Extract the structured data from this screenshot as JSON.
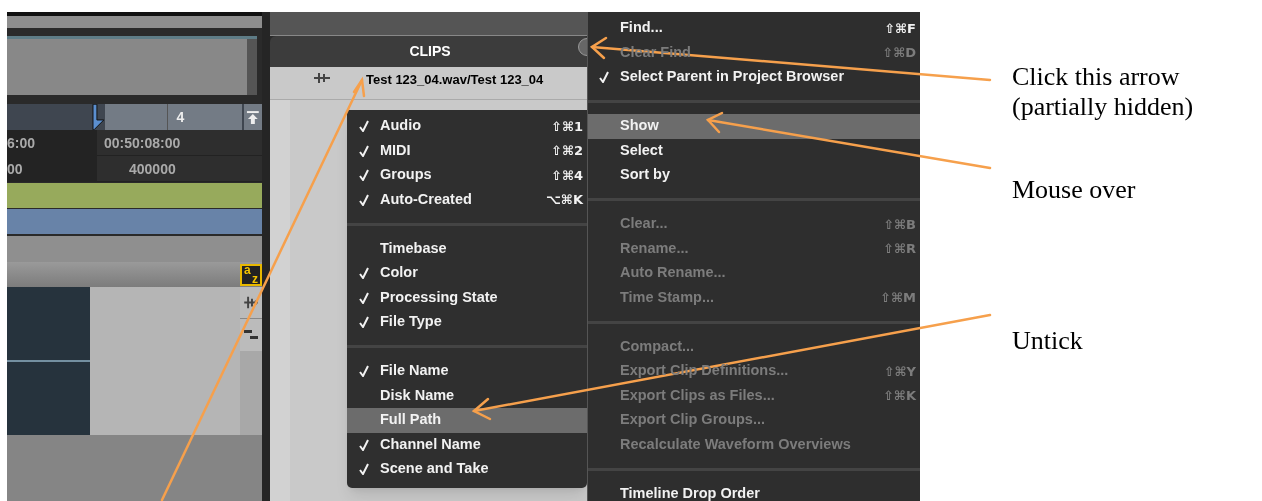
{
  "timeline": {
    "bar_number": "4",
    "rows": [
      [
        "6:00",
        "00:50:08:00"
      ],
      [
        "00",
        "400000"
      ]
    ]
  },
  "sort_button": {
    "top": "a",
    "bottom": "z"
  },
  "clips": {
    "title": "CLIPS",
    "rows": [
      "Test 123_04.wav/Test 123_04"
    ]
  },
  "show_submenu": {
    "groups": [
      [
        {
          "label": "Audio",
          "shortcut": "⇧⌘1",
          "checked": true,
          "selected": false
        },
        {
          "label": "MIDI",
          "shortcut": "⇧⌘2",
          "checked": true,
          "selected": false
        },
        {
          "label": "Groups",
          "shortcut": "⇧⌘4",
          "checked": true,
          "selected": false
        },
        {
          "label": "Auto-Created",
          "shortcut": "⌥⌘K",
          "checked": true,
          "selected": false
        }
      ],
      [
        {
          "label": "Timebase",
          "checked": false,
          "selected": false
        },
        {
          "label": "Color",
          "checked": true,
          "selected": false
        },
        {
          "label": "Processing State",
          "checked": true,
          "selected": false
        },
        {
          "label": "File Type",
          "checked": true,
          "selected": false
        }
      ],
      [
        {
          "label": "File Name",
          "checked": true,
          "selected": false
        },
        {
          "label": "Disk Name",
          "checked": false,
          "selected": false
        },
        {
          "label": "Full Path",
          "checked": false,
          "selected": true
        },
        {
          "label": "Channel Name",
          "checked": true,
          "selected": false
        },
        {
          "label": "Scene and Take",
          "checked": true,
          "selected": false
        }
      ]
    ]
  },
  "menu": {
    "groups": [
      [
        {
          "label": "Find...",
          "shortcut": "⇧⌘F",
          "checked": false,
          "disabled": false,
          "selected": false
        },
        {
          "label": "Clear Find",
          "shortcut": "⇧⌘D",
          "checked": false,
          "disabled": true,
          "selected": false
        },
        {
          "label": "Select Parent in Project Browser",
          "checked": true,
          "disabled": false,
          "selected": false
        }
      ],
      [
        {
          "label": "Show",
          "checked": false,
          "disabled": false,
          "selected": true
        },
        {
          "label": "Select",
          "checked": false,
          "disabled": false,
          "selected": false
        },
        {
          "label": "Sort by",
          "checked": false,
          "disabled": false,
          "selected": false
        }
      ],
      [
        {
          "label": "Clear...",
          "shortcut": "⇧⌘B",
          "checked": false,
          "disabled": true,
          "selected": false
        },
        {
          "label": "Rename...",
          "shortcut": "⇧⌘R",
          "checked": false,
          "disabled": true,
          "selected": false
        },
        {
          "label": "Auto Rename...",
          "checked": false,
          "disabled": true,
          "selected": false
        },
        {
          "label": "Time Stamp...",
          "shortcut": "⇧⌘M",
          "checked": false,
          "disabled": true,
          "selected": false
        }
      ],
      [
        {
          "label": "Compact...",
          "checked": false,
          "disabled": true,
          "selected": false
        },
        {
          "label": "Export Clip Definitions...",
          "shortcut": "⇧⌘Y",
          "checked": false,
          "disabled": true,
          "selected": false
        },
        {
          "label": "Export Clips as Files...",
          "shortcut": "⇧⌘K",
          "checked": false,
          "disabled": true,
          "selected": false
        },
        {
          "label": "Export Clip Groups...",
          "checked": false,
          "disabled": true,
          "selected": false
        },
        {
          "label": "Recalculate Waveform Overviews",
          "checked": false,
          "disabled": true,
          "selected": false
        }
      ],
      [
        {
          "label": "Timeline Drop Order",
          "checked": false,
          "disabled": false,
          "selected": false
        }
      ]
    ]
  },
  "annotations": [
    {
      "lines": [
        "Click this arrow",
        "(partially hidden)"
      ]
    },
    {
      "lines": [
        "Mouse over"
      ]
    },
    {
      "lines": [
        "Untick"
      ]
    }
  ]
}
